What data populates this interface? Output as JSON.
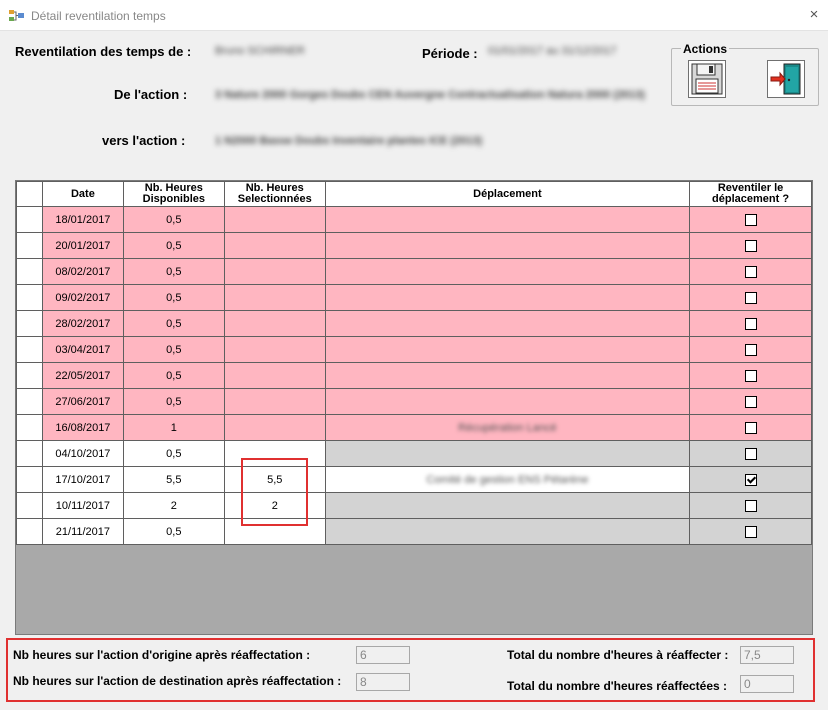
{
  "window": {
    "title": "Détail reventilation temps",
    "close_icon": "×"
  },
  "header": {
    "reventilation_label": "Reventilation des temps de :",
    "reventilation_value": "Bruno SCHIRNER",
    "periode_label": "Période :",
    "periode_value": "01/01/2017 au 31/12/2017",
    "de_action_label": "De l'action :",
    "de_action_value": "3 Nature 2000 Gorges Doubs CEN Auvergne Contractualisation Natura 2000 (2013)",
    "vers_action_label": "vers l'action :",
    "vers_action_value": "1 N2000 Basse Doubs Inventaire plantes ICE (2013)"
  },
  "actions": {
    "legend": "Actions",
    "save_icon": "floppy-disk-icon",
    "exit_icon": "exit-door-icon"
  },
  "grid": {
    "columns": [
      "",
      "Date",
      "Nb. Heures Disponibles",
      "Nb. Heures Selectionnées",
      "Déplacement",
      "Reventiler le déplacement ?"
    ],
    "rows": [
      {
        "date": "18/01/2017",
        "dispo": "0,5",
        "sel": "",
        "deplacement": "",
        "checked": false,
        "style": "pink"
      },
      {
        "date": "20/01/2017",
        "dispo": "0,5",
        "sel": "",
        "deplacement": "",
        "checked": false,
        "style": "pink"
      },
      {
        "date": "08/02/2017",
        "dispo": "0,5",
        "sel": "",
        "deplacement": "",
        "checked": false,
        "style": "pink"
      },
      {
        "date": "09/02/2017",
        "dispo": "0,5",
        "sel": "",
        "deplacement": "",
        "checked": false,
        "style": "pink"
      },
      {
        "date": "28/02/2017",
        "dispo": "0,5",
        "sel": "",
        "deplacement": "",
        "checked": false,
        "style": "pink"
      },
      {
        "date": "03/04/2017",
        "dispo": "0,5",
        "sel": "",
        "deplacement": "",
        "checked": false,
        "style": "pink"
      },
      {
        "date": "22/05/2017",
        "dispo": "0,5",
        "sel": "",
        "deplacement": "",
        "checked": false,
        "style": "pink"
      },
      {
        "date": "27/06/2017",
        "dispo": "0,5",
        "sel": "",
        "deplacement": "",
        "checked": false,
        "style": "pink"
      },
      {
        "date": "16/08/2017",
        "dispo": "1",
        "sel": "",
        "deplacement": "Récupération Lancé",
        "checked": false,
        "style": "pink"
      },
      {
        "date": "04/10/2017",
        "dispo": "0,5",
        "sel": "",
        "deplacement": "",
        "checked": false,
        "style": "white",
        "dep_gray": true
      },
      {
        "date": "17/10/2017",
        "dispo": "5,5",
        "sel": "5,5",
        "deplacement": "Comité de gestion ENS Pétarène",
        "checked": true,
        "style": "white",
        "dep_gray": false
      },
      {
        "date": "10/11/2017",
        "dispo": "2",
        "sel": "2",
        "deplacement": "",
        "checked": false,
        "style": "white",
        "dep_gray": true
      },
      {
        "date": "21/11/2017",
        "dispo": "0,5",
        "sel": "",
        "deplacement": "",
        "checked": false,
        "style": "white",
        "dep_gray": true
      }
    ]
  },
  "footer": {
    "origine_label": "Nb heures sur l'action d'origine après réaffectation :",
    "origine_value": "6",
    "destination_label": "Nb heures sur l'action de destination après réaffectation :",
    "destination_value": "8",
    "total_a_reaffecter_label": "Total du nombre d'heures à réaffecter :",
    "total_a_reaffecter_value": "7,5",
    "total_reaffectees_label": "Total du nombre d'heures réaffectées :",
    "total_reaffectees_value": "0"
  },
  "colors": {
    "pink": "#ffb6c1",
    "gray": "#d3d3d3",
    "highlight": "#e03030"
  }
}
